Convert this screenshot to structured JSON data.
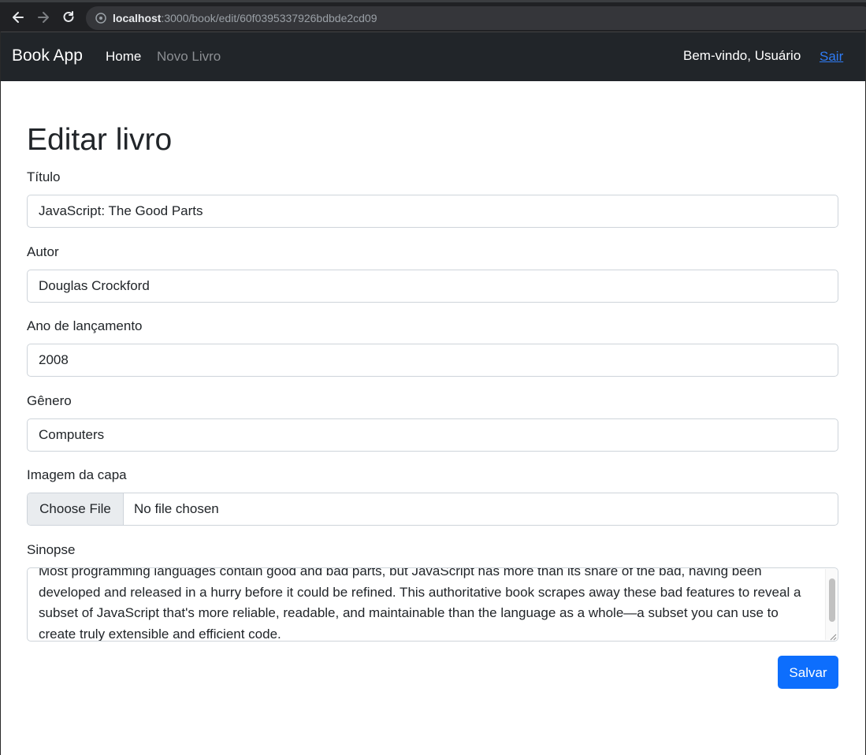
{
  "browser": {
    "url_host": "localhost",
    "url_path": ":3000/book/edit/60f0395337926bdbde2cd09"
  },
  "navbar": {
    "brand": "Book App",
    "home": "Home",
    "new_book": "Novo Livro",
    "welcome": "Bem-vindo, Usuário",
    "logout": "Sair"
  },
  "form": {
    "title": "Editar livro",
    "title_label": "Título",
    "title_value": "JavaScript: The Good Parts",
    "author_label": "Autor",
    "author_value": "Douglas Crockford",
    "year_label": "Ano de lançamento",
    "year_value": "2008",
    "genre_label": "Gênero",
    "genre_value": "Computers",
    "cover_label": "Imagem da capa",
    "cover_button": "Choose File",
    "cover_status": "No file chosen",
    "synopsis_label": "Sinopse",
    "synopsis_value": "Most programming languages contain good and bad parts, but JavaScript has more than its share of the bad, having been developed and released in a hurry before it could be refined. This authoritative book scrapes away these bad features to reveal a subset of JavaScript that's more reliable, readable, and maintainable than the language as a whole—a subset you can use to create truly extensible and efficient code.",
    "save": "Salvar"
  },
  "colors": {
    "navbar_bg": "#212529",
    "primary": "#0d6efd",
    "link": "#2f7cf6"
  }
}
